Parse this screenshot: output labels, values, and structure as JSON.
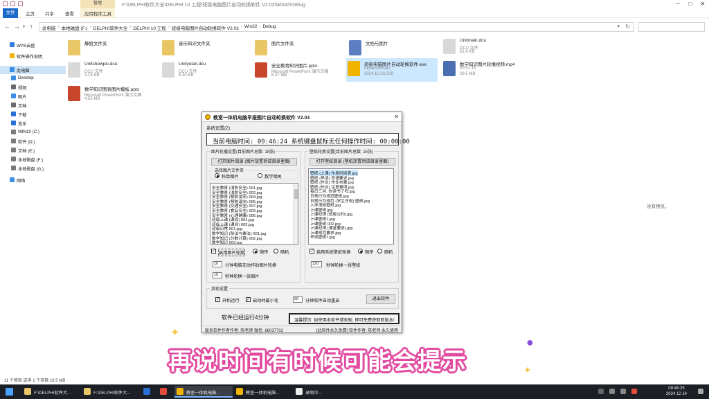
{
  "explorer": {
    "title_path": "F:\\DELPHI软件大全\\DELPHI 10 工程\\班级电脑图片自动轮换软件 V2.03\\Win32\\Debug",
    "context_tab": "管理",
    "ribbon_tabs": [
      "文件",
      "主页",
      "共享",
      "查看",
      "应用程序工具"
    ],
    "breadcrumbs": [
      "此电脑",
      "本地磁盘 (F:)",
      "DELPHI软件大全",
      "DELPHI 10 工程",
      "班级电脑图片自动轮换软件 V2.03",
      "Win32",
      "Debug"
    ],
    "nav_items": [
      {
        "label": "WPS云盘",
        "color": "#2f7de1"
      },
      {
        "label": "软件操作说明",
        "color": "#f0b400"
      },
      {
        "label": "此电脑",
        "color": "#3a8ee6"
      },
      {
        "label": "Desktop",
        "color": "#3a8ee6"
      },
      {
        "label": "视频",
        "color": "#6a6a6a"
      },
      {
        "label": "图片",
        "color": "#3a8ee6"
      },
      {
        "label": "文档",
        "color": "#6a6a6a"
      },
      {
        "label": "下载",
        "color": "#2a6fd6"
      },
      {
        "label": "音乐",
        "color": "#2a6fd6"
      },
      {
        "label": "WIN10 (C:)",
        "color": "#7a7a7a"
      },
      {
        "label": "软件 (D:)",
        "color": "#7a7a7a"
      },
      {
        "label": "文档 (E:)",
        "color": "#7a7a7a"
      },
      {
        "label": "本地磁盘 (F:)",
        "color": "#7a7a7a"
      },
      {
        "label": "本地磁盘 (G:)",
        "color": "#7a7a7a"
      },
      {
        "label": "网络",
        "color": "#3a8ee6"
      }
    ],
    "files": [
      {
        "name": "静姐文件夹",
        "meta1": "",
        "meta2": "",
        "color": "#e9c766"
      },
      {
        "name": "音乐知识文件夹",
        "meta1": "",
        "meta2": "",
        "color": "#e9c766"
      },
      {
        "name": "图片文件夹",
        "meta1": "",
        "meta2": "",
        "color": "#e9c766"
      },
      {
        "name": "文档与图片",
        "meta1": "",
        "meta2": "",
        "color": "#5b7fc2"
      },
      {
        "name": "Unitmain.dcu",
        "meta1": "DCU 文件",
        "meta2": "61.6 KB",
        "color": "#d9d9d9"
      },
      {
        "name": "Unitshowpic.dcu",
        "meta1": "DCU 文件",
        "meta2": "9.15 KB",
        "color": "#d9d9d9"
      },
      {
        "name": "Unityulan.dcu",
        "meta1": "DCU 文件",
        "meta2": "6.30 KB",
        "color": "#d9d9d9"
      },
      {
        "name": "安全教育知识图片.pptx",
        "meta1": "Microsoft PowerPoint 演示文稿",
        "meta2": "6.37 MB",
        "color": "#c8462b"
      },
      {
        "name": "班级电脑图片自动轮换软件.exe",
        "meta1": "tupianlunhuan",
        "meta2": "2024.10.20.208",
        "color": "#f0b400"
      },
      {
        "name": "数学知识图片轮播视频.mp4",
        "meta1": "00:01:15",
        "meta2": "29.5 MB",
        "color": "#4a6fb0"
      },
      {
        "name": "数学知识图表图片模板.pptx",
        "meta1": "Microsoft PowerPoint 演示文稿",
        "meta2": "4.55 MB",
        "color": "#c8462b"
      }
    ],
    "no_preview": "没有预览。",
    "status": "11 个项目  选中 1 个项目  18.5 MB"
  },
  "app": {
    "title": "教室一体机电脑早报图片自动轮换软件 V2.03",
    "menu": "系统设置(Z)",
    "time_display": "当前电脑时间:  09:46:24   系统键盘鼠标无任何操作时间: 00:00:00",
    "left_group": {
      "title": "图片轮播设置(目前图片总数: 18张)",
      "open_btn": "打开图片目录 (图片放置到该目录里面)",
      "folder_sel_title": "选择图片文件夹",
      "radio1": "科目图片",
      "radio2": "数学相关",
      "list": [
        "安全教育 (消防安全) 001.jpg",
        "安全教育 (消防安全) 002.jpg",
        "安全教育 (预防溺水) 004.jpg",
        "安全教育 (预防溺水) 005.jpg",
        "安全教育 (交通安全) 007.jpg",
        "安全教育 (食品安全) 003.jpg",
        "安全教育 (心理健康) 006.jpg",
        "班级上课 (课间) 001.jpg",
        "班级上课 (课间) 002.jpg",
        "班级日常 001.jpg",
        "数学知识 (除法与乘法) 001.jpg",
        "数学知识 (分数计算) 002.jpg",
        "数学知识 003.jpg"
      ],
      "enable": "启用图片轮换",
      "order": "顺序",
      "random": "随机",
      "spin1": "10",
      "spin1_label": "分钟电脑无动作后图片轮换",
      "spin2": "10",
      "spin2_label": "秒钟轮换一张图片"
    },
    "right_group": {
      "title": "壁纸轮换设置(目前图片总数: 15张)",
      "open_btn": "打开壁纸目录 (壁纸放置到该目录里面)",
      "list": [
        "壁纸 (上课) 作息时间表.jpg",
        "壁纸 (早读) 背诵要求.jpg",
        "壁纸 (作业) 作业布置.jpg",
        "壁纸 (作业) 注意事项.jpg",
        "每日三问: 你读书了吗.jpg",
        "日常行为规范壁纸.jpg",
        "日常行为规范 (学生守则) 壁纸.jpg",
        "入学须知壁纸.jpg",
        "上课壁纸.jpg",
        "上课纪律 (班级公约).jpg",
        "上课壁纸1.jpg",
        "上课壁纸 002.jpg",
        "上课纪律 (课堂要求).jpg",
        "上课规范要求.jpg",
        "早读壁纸1.jpg"
      ],
      "enable": "启用系统壁纸轮换",
      "order": "顺序",
      "random": "随机",
      "spin": "120",
      "spin_label": "秒钟轮换一张壁纸"
    },
    "other_group": {
      "title": "其他设置",
      "autostart": "开机运行",
      "minimize": "启动时最小化",
      "spin": "60",
      "spin_label": "分钟软件自动重启",
      "exit_btn": "退出软件"
    },
    "uptime": "软件已经运行4分钟",
    "tip": "温馨提示: 如使用本软件请告知, 即可免费获取新版本!",
    "status_left": "联系软件作者作者: 陈老师   微信: 88037702",
    "status_right": "[此软件永久免费] 软件作者: 陈老师 永久使用"
  },
  "subtitle": "再说时间有时候可能会提示",
  "taskbar": {
    "items": [
      {
        "label": "F:\\DELPHI软件大...",
        "color": "#e9c766",
        "active": false
      },
      {
        "label": "F:\\DELPHI软件大...",
        "color": "#e9c766",
        "active": false
      },
      {
        "label": "",
        "color": "#2a6fd6",
        "active": false
      },
      {
        "label": "",
        "color": "#e24a3a",
        "active": false
      },
      {
        "label": "",
        "color": "#f0b400",
        "active": false
      },
      {
        "label": "教室一体机电脑...",
        "color": "#f0b400",
        "active": true
      },
      {
        "label": "教室一体机电脑...",
        "color": "#f0b400",
        "active": false
      },
      {
        "label": "录制中...",
        "color": "#eeeeee",
        "active": false
      }
    ],
    "time": "09:46:25",
    "date": "2024 12 14"
  }
}
